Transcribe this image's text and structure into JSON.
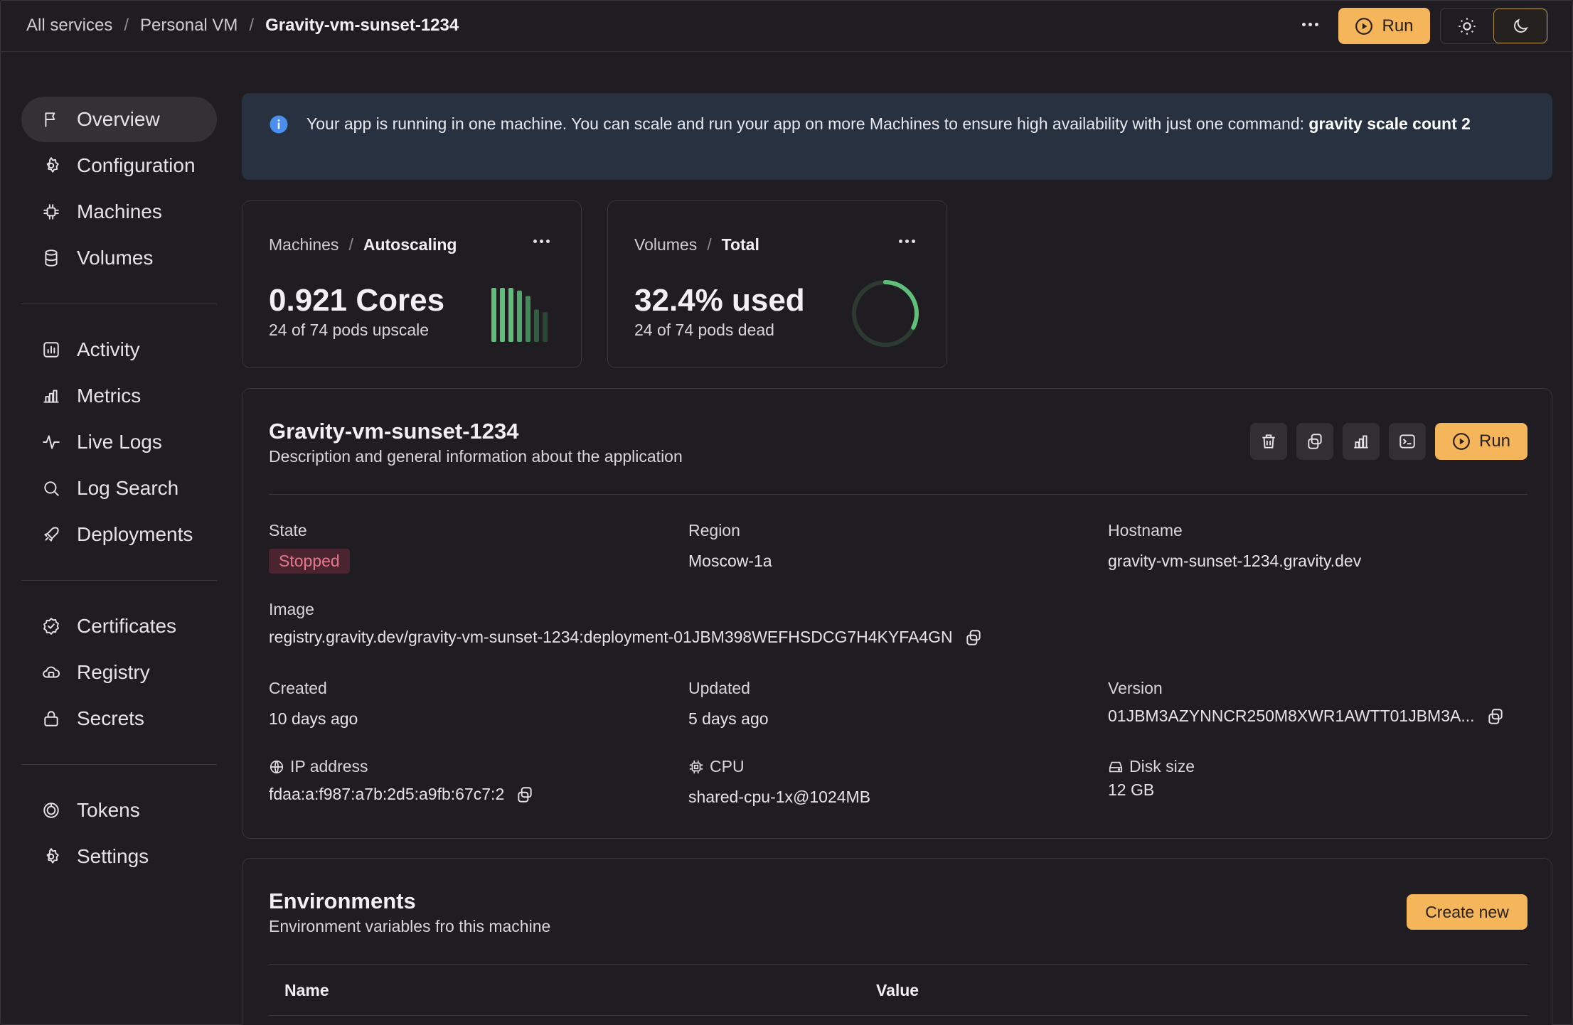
{
  "breadcrumbs": [
    "All services",
    "Personal VM",
    "Gravity-vm-sunset-1234"
  ],
  "topbar": {
    "run_label": "Run",
    "light_icon": "sun-icon",
    "dark_icon": "moon-icon",
    "active_theme": "dark"
  },
  "sidebar": {
    "groups": [
      [
        {
          "label": "Overview",
          "icon": "flag-icon",
          "active": true
        },
        {
          "label": "Configuration",
          "icon": "gear-icon"
        },
        {
          "label": "Machines",
          "icon": "chip-icon"
        },
        {
          "label": "Volumes",
          "icon": "database-icon"
        }
      ],
      [
        {
          "label": "Activity",
          "icon": "activity-chart-icon"
        },
        {
          "label": "Metrics",
          "icon": "bar-chart-icon"
        },
        {
          "label": "Live Logs",
          "icon": "pulse-icon"
        },
        {
          "label": "Log Search",
          "icon": "search-icon"
        },
        {
          "label": "Deployments",
          "icon": "rocket-icon"
        }
      ],
      [
        {
          "label": "Certificates",
          "icon": "badge-check-icon"
        },
        {
          "label": "Registry",
          "icon": "cloud-box-icon"
        },
        {
          "label": "Secrets",
          "icon": "lock-icon"
        }
      ],
      [
        {
          "label": "Tokens",
          "icon": "token-icon"
        },
        {
          "label": "Settings",
          "icon": "gear-icon"
        }
      ]
    ]
  },
  "alert": {
    "text": "Your app is running in one machine. You can scale and run your app on more Machines to ensure high availability with just one command: ",
    "command": "gravity scale count 2"
  },
  "machines_card": {
    "crumb": "Machines",
    "title": "Autoscaling",
    "value": "0.921 Cores",
    "sub": "24 of 74 pods upscale",
    "bars": [
      1,
      1,
      1,
      0.95,
      0.85,
      0.6,
      0.55
    ]
  },
  "volumes_card": {
    "crumb": "Volumes",
    "title": "Total",
    "value": "32.4% used",
    "sub": "24 of 74 pods dead",
    "fraction": 0.324
  },
  "detail": {
    "title": "Gravity-vm-sunset-1234",
    "description": "Description and general information about the application",
    "run_label": "Run",
    "state_label": "State",
    "state": "Stopped",
    "region_label": "Region",
    "region": "Moscow-1a",
    "hostname_label": "Hostname",
    "hostname": "gravity-vm-sunset-1234.gravity.dev",
    "image_label": "Image",
    "image": "registry.gravity.dev/gravity-vm-sunset-1234:deployment-01JBM398WEFHSDCG7H4KYFA4GN",
    "created_label": "Created",
    "created": "10 days ago",
    "updated_label": "Updated",
    "updated": "5 days ago",
    "version_label": "Version",
    "version": "01JBM3AZYNNCR250M8XWR1AWTT01JBM3A...",
    "ip_label": "IP address",
    "ip": "fdaa:a:f987:a7b:2d5:a9fb:67c7:2",
    "cpu_label": "CPU",
    "cpu": "shared-cpu-1x@1024MB",
    "disk_label": "Disk size",
    "disk": "12 GB"
  },
  "environments": {
    "title": "Environments",
    "description": "Environment variables fro this machine",
    "create_label": "Create new",
    "columns": [
      "Name",
      "Value"
    ]
  },
  "colors": {
    "accent": "#f4b55b",
    "chart_green": "#5fbf7a",
    "stopped": "#e8768c"
  }
}
